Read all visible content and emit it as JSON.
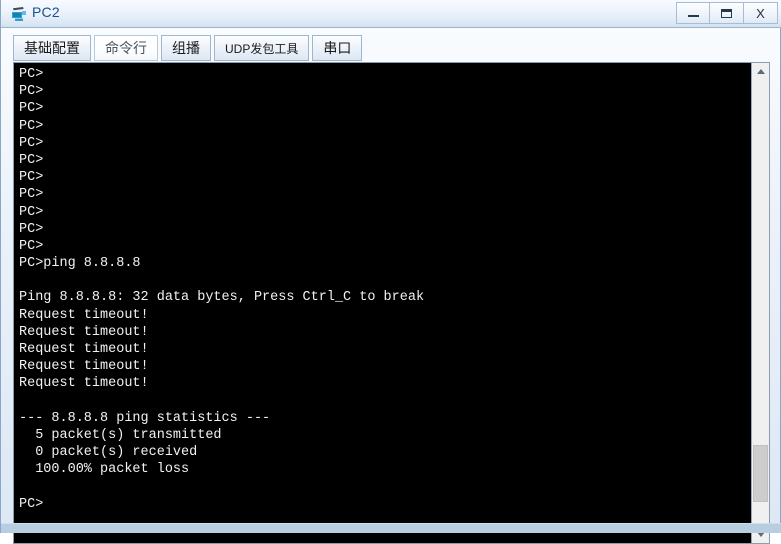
{
  "window": {
    "title": "PC2",
    "icon": "pc-device-icon",
    "controls": [
      {
        "name": "minimize-button",
        "label": "–",
        "icon": "minimize-icon"
      },
      {
        "name": "maximize-button",
        "label": "▭",
        "icon": "maximize-icon"
      },
      {
        "name": "close-button",
        "label": "X",
        "icon": "close-icon"
      }
    ]
  },
  "tabs": [
    {
      "label": "基础配置",
      "selected": false,
      "name": "tab-basic-config"
    },
    {
      "label": "命令行",
      "selected": true,
      "name": "tab-command-line"
    },
    {
      "label": "组播",
      "selected": false,
      "name": "tab-multicast"
    },
    {
      "label": "UDP发包工具",
      "selected": false,
      "name": "tab-udp-tool"
    },
    {
      "label": "串口",
      "selected": false,
      "name": "tab-serial-port"
    }
  ],
  "terminal": {
    "prompt": "PC>",
    "command": "ping 8.8.8.8",
    "lines": [
      "PC>",
      "PC>",
      "PC>",
      "PC>",
      "PC>",
      "PC>",
      "PC>",
      "PC>",
      "PC>",
      "PC>",
      "PC>",
      "PC>ping 8.8.8.8",
      "",
      "Ping 8.8.8.8: 32 data bytes, Press Ctrl_C to break",
      "Request timeout!",
      "Request timeout!",
      "Request timeout!",
      "Request timeout!",
      "Request timeout!",
      "",
      "--- 8.8.8.8 ping statistics ---",
      "  5 packet(s) transmitted",
      "  0 packet(s) received",
      "  100.00% packet loss",
      "",
      "PC>"
    ],
    "stats": {
      "target": "8.8.8.8",
      "data_bytes": 32,
      "transmitted": 5,
      "received": 0,
      "packet_loss": "100.00%"
    },
    "colors": {
      "background": "#000000",
      "text": "#f2f2f2"
    }
  },
  "scrollbar": {
    "up_arrow": "scroll-up-arrow",
    "down_arrow": "scroll-down-arrow",
    "thumb": "scroll-thumb"
  }
}
